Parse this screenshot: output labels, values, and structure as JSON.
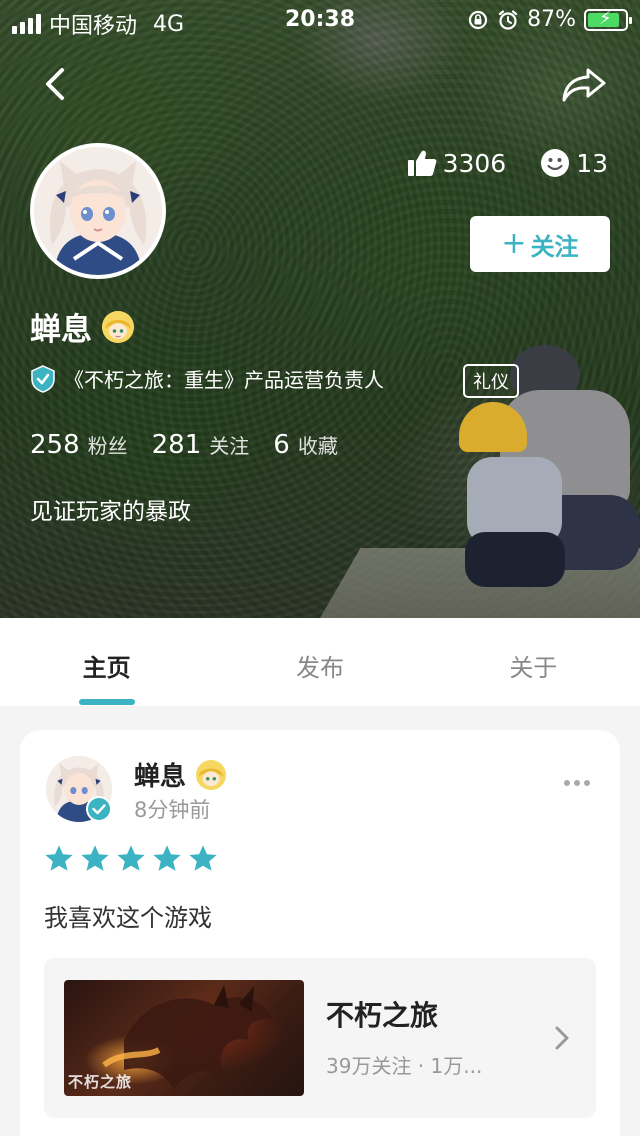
{
  "status_bar": {
    "carrier": "中国移动",
    "network": "4G",
    "time": "20:38",
    "battery": "87%",
    "battery_level": 0.87
  },
  "profile": {
    "name": "蝉息",
    "likes": "3306",
    "smiles": "13",
    "follow_label": "关注",
    "follow_plus": "+",
    "verify_text": "《不朽之旅：重生》产品运营负责人",
    "verify_tag": "礼仪",
    "fans_count": "258",
    "fans_label": "粉丝",
    "following_count": "281",
    "following_label": "关注",
    "favorites_count": "6",
    "favorites_label": "收藏",
    "bio": "见证玩家的暴政"
  },
  "tabs": [
    {
      "label": "主页",
      "active": true
    },
    {
      "label": "发布",
      "active": false
    },
    {
      "label": "关于",
      "active": false
    }
  ],
  "post": {
    "author": "蝉息",
    "time": "8分钟前",
    "rating": 5,
    "rating_max": 5,
    "text": "我喜欢这个游戏",
    "game": {
      "title": "不朽之旅",
      "meta": "39万关注 · 1万...",
      "image_caption": "不朽之旅"
    }
  },
  "colors": {
    "accent": "#3bb3c3",
    "star": "#3bb3c3",
    "battery_fill": "#4cd964"
  },
  "icons": [
    "back-arrow-icon",
    "share-icon",
    "thumbs-up-icon",
    "smiley-icon",
    "verified-icon",
    "more-dots-icon",
    "chevron-right-icon",
    "star-icon"
  ]
}
